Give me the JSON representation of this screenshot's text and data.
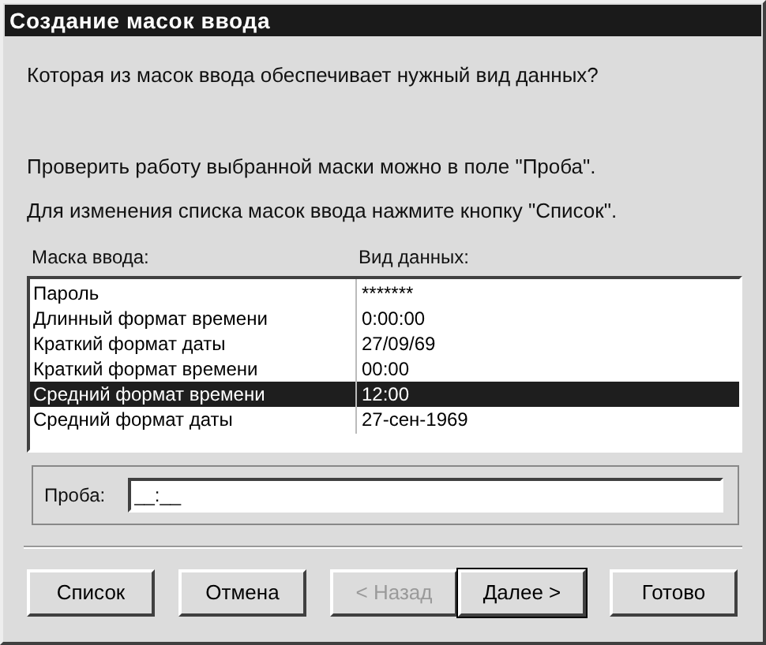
{
  "window": {
    "title": "Создание масок ввода"
  },
  "question": "Которая из масок ввода обеспечивает нужный вид данных?",
  "hints": [
    "Проверить работу выбранной маски можно в поле \"Проба\".",
    "Для изменения списка масок ввода нажмите кнопку \"Список\"."
  ],
  "table": {
    "columns": [
      "Маска ввода:",
      "Вид данных:"
    ],
    "rows": [
      {
        "mask": "Пароль",
        "sample": "*******",
        "selected": false
      },
      {
        "mask": "Длинный формат времени",
        "sample": "0:00:00",
        "selected": false
      },
      {
        "mask": "Краткий формат даты",
        "sample": "27/09/69",
        "selected": false
      },
      {
        "mask": "Краткий формат времени",
        "sample": "00:00",
        "selected": false
      },
      {
        "mask": "Средний формат времени",
        "sample": "12:00",
        "selected": true
      },
      {
        "mask": "Средний формат даты",
        "sample": "27-сен-1969",
        "selected": false
      }
    ]
  },
  "test_field": {
    "label": "Проба:",
    "value": "__:__"
  },
  "buttons": [
    {
      "label": "Список",
      "disabled": false,
      "default": false
    },
    {
      "label": "Отмена",
      "disabled": false,
      "default": false
    },
    {
      "label": "< Назад",
      "disabled": true,
      "default": false
    },
    {
      "label": "Далее >",
      "disabled": false,
      "default": true
    },
    {
      "label": "Готово",
      "disabled": false,
      "default": false
    }
  ]
}
